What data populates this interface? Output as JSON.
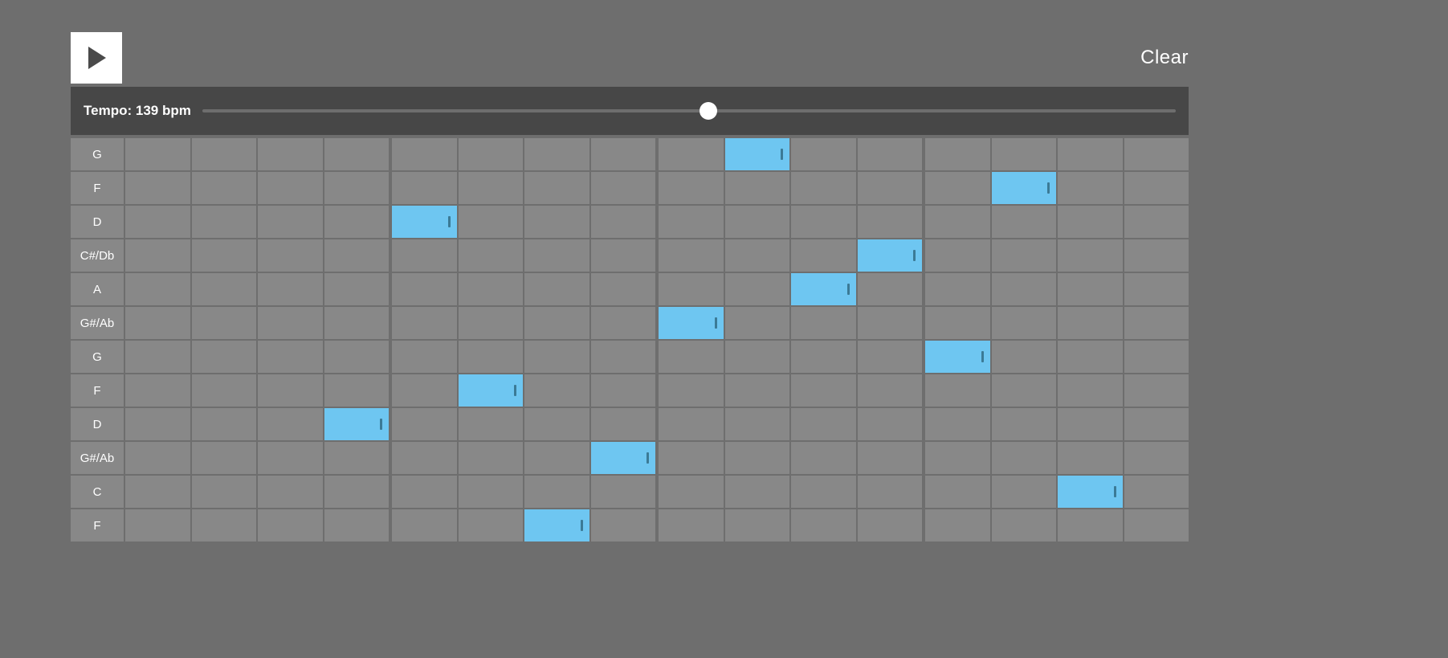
{
  "controls": {
    "play_icon": "play-icon",
    "clear_label": "Clear"
  },
  "tempo": {
    "label_prefix": "Tempo: ",
    "value": 139,
    "unit": " bpm",
    "min": 40,
    "max": 240,
    "thumb_percent": 52
  },
  "grid": {
    "columns": 16,
    "rows": [
      {
        "label": "G",
        "active": [
          9
        ]
      },
      {
        "label": "F",
        "active": [
          13
        ]
      },
      {
        "label": "D",
        "active": [
          4
        ]
      },
      {
        "label": "C#/Db",
        "active": [
          11
        ]
      },
      {
        "label": "A",
        "active": [
          10
        ]
      },
      {
        "label": "G#/Ab",
        "active": [
          8
        ]
      },
      {
        "label": "G",
        "active": [
          12
        ]
      },
      {
        "label": "F",
        "active": [
          5
        ]
      },
      {
        "label": "D",
        "active": [
          3
        ]
      },
      {
        "label": "G#/Ab",
        "active": [
          7
        ]
      },
      {
        "label": "C",
        "active": [
          14
        ]
      },
      {
        "label": "F",
        "active": [
          6
        ]
      }
    ]
  },
  "colors": {
    "background": "#6e6e6e",
    "panel": "#474747",
    "cell": "#888888",
    "cell_active": "#6ec6f1",
    "cell_tick": "#3b7a96",
    "text": "#ffffff"
  }
}
